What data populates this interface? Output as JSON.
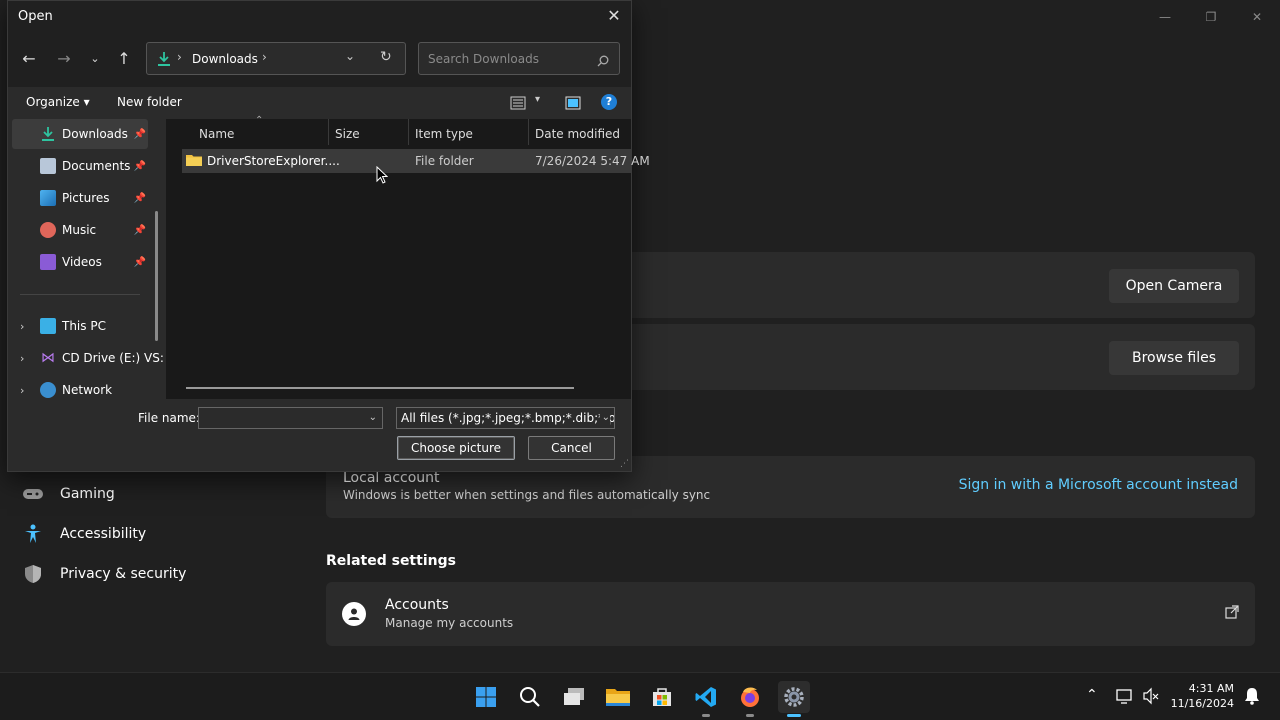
{
  "settings": {
    "window_controls": {
      "minimize": "—",
      "maximize": "❐",
      "close": "✕"
    },
    "camera_card": {
      "button": "Open Camera"
    },
    "files_card": {
      "button": "Browse files"
    },
    "account": {
      "title": "Local account",
      "subtitle": "Windows is better when settings and files automatically sync",
      "link": "Sign in with a Microsoft account instead"
    },
    "related_heading": "Related settings",
    "accounts_card": {
      "title": "Accounts",
      "subtitle": "Manage my accounts"
    },
    "nav": [
      {
        "label": "Gaming",
        "icon": "gamepad-icon"
      },
      {
        "label": "Accessibility",
        "icon": "accessibility-icon"
      },
      {
        "label": "Privacy & security",
        "icon": "shield-icon"
      }
    ]
  },
  "dialog": {
    "title": "Open",
    "address": {
      "location": "Downloads"
    },
    "search": {
      "placeholder": "Search Downloads"
    },
    "commands": {
      "organize": "Organize",
      "new_folder": "New folder"
    },
    "sidebar": [
      {
        "label": "Downloads",
        "icon": "downloads-icon",
        "pinned": true,
        "selected": true
      },
      {
        "label": "Documents",
        "icon": "documents-icon",
        "pinned": true
      },
      {
        "label": "Pictures",
        "icon": "pictures-icon",
        "pinned": true
      },
      {
        "label": "Music",
        "icon": "music-icon",
        "pinned": true
      },
      {
        "label": "Videos",
        "icon": "videos-icon",
        "pinned": true
      },
      {
        "label": "This PC",
        "icon": "pc-icon",
        "expandable": true
      },
      {
        "label": "CD Drive (E:) VS:",
        "icon": "cd-drive-icon",
        "expandable": true
      },
      {
        "label": "Network",
        "icon": "network-icon",
        "expandable": true
      }
    ],
    "columns": [
      "Name",
      "Size",
      "Item type",
      "Date modified"
    ],
    "files": [
      {
        "name": "DriverStoreExplorer....",
        "size": "",
        "type": "File folder",
        "modified": "7/26/2024 5:47 AM"
      }
    ],
    "file_name": {
      "label": "File name:",
      "value": ""
    },
    "filter": "All files (*.jpg;*.jpeg;*.bmp;*.dib;*.png",
    "buttons": {
      "choose": "Choose picture",
      "cancel": "Cancel"
    }
  },
  "taskbar": {
    "apps": [
      "start-icon",
      "search-icon",
      "task-view-icon",
      "file-explorer-icon",
      "store-icon",
      "vscode-icon",
      "firefox-icon",
      "settings-icon"
    ],
    "clock": {
      "time": "4:31 AM",
      "date": "11/16/2024"
    }
  },
  "colors": {
    "accent": "#0078d4",
    "link": "#60cdff",
    "folder": "#f0c040"
  }
}
